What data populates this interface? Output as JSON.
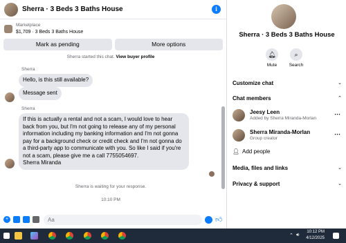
{
  "header": {
    "title": "Sherra · 3 Beds 3 Baths House",
    "info_icon": "i"
  },
  "listing": {
    "category": "Marketplace",
    "text": "$1,709 · 3 Beds 3 Baths House"
  },
  "actions": {
    "pending": "Mark as pending",
    "more": "More options"
  },
  "chat": {
    "started_text": "Sherra started this chat.",
    "started_link": "View buyer profile",
    "messages": [
      {
        "sender": "Sherra",
        "text": "Hello, is this still available?"
      },
      {
        "text": "Message sent"
      },
      {
        "sender": "Sherra",
        "text": "If this is actually a rental and not a scam, I would love to hear back from you, but I'm not going to release any of my personal information including my banking information and I'm not gonna pay for a background check or credit check and I'm not gonna do a third-party app to communicate with you. So like I said if you're not a scam, please give me a call 7755054697.\nSherra Miranda"
      }
    ],
    "waiting": "Sherra is waiting for your response.",
    "time": "10:10 PM"
  },
  "composer": {
    "placeholder": "Aa"
  },
  "profile": {
    "name": "Sherra · 3 Beds 3 Baths House",
    "mute_label": "Mute",
    "search_label": "Search"
  },
  "sections": {
    "customize": "Customize chat",
    "members": "Chat members",
    "media": "Media, files and links",
    "privacy": "Privacy & support",
    "add_people": "Add people"
  },
  "members": [
    {
      "name": "Jeesy Leen",
      "sub": "Added by Sherra Miranda-Morlan"
    },
    {
      "name": "Sherra Miranda-Morlan",
      "sub": "Group creator"
    }
  ],
  "taskbar": {
    "time": "10:12 PM",
    "date": "4/12/2025"
  },
  "colors": {
    "accent": "#0a7cff",
    "bubble": "#e4e6eb",
    "taskbar": "#1f2a3a"
  }
}
